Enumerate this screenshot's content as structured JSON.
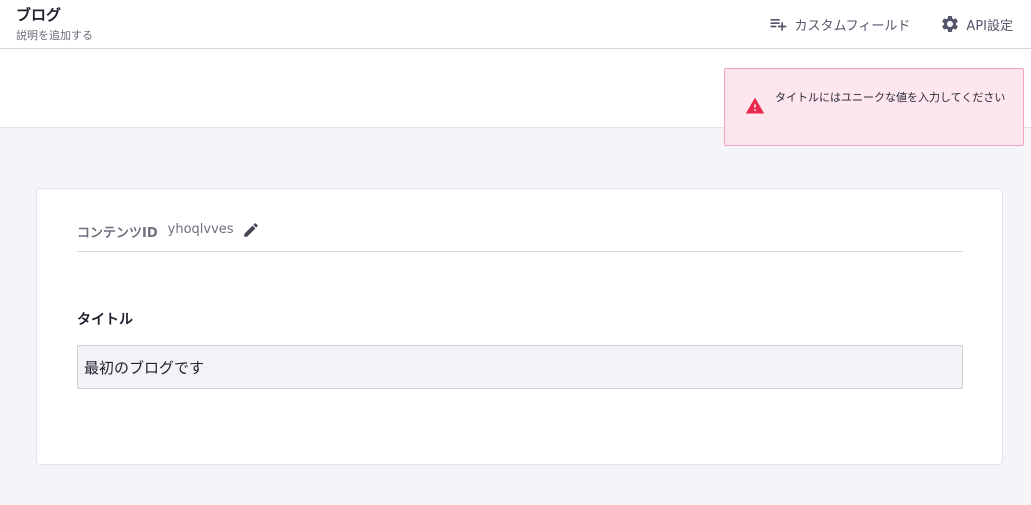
{
  "header": {
    "title": "ブログ",
    "description": "説明を追加する",
    "actions": [
      {
        "label": "カスタムフィールド",
        "icon": "playlist-add-icon"
      },
      {
        "label": "API設定",
        "icon": "gear-icon"
      }
    ]
  },
  "toast": {
    "icon": "warning-icon",
    "message": "タイトルにはユニークな値を入力してください"
  },
  "content": {
    "id_label": "コンテンツID",
    "id_value": "yhoqlvves",
    "title_label": "タイトル",
    "title_value": "最初のブログです"
  },
  "colors": {
    "toast_bg": "#fde6ee",
    "toast_border": "#f4a3bc",
    "warning": "#e8294c",
    "page_bg": "#f5f4f9"
  }
}
